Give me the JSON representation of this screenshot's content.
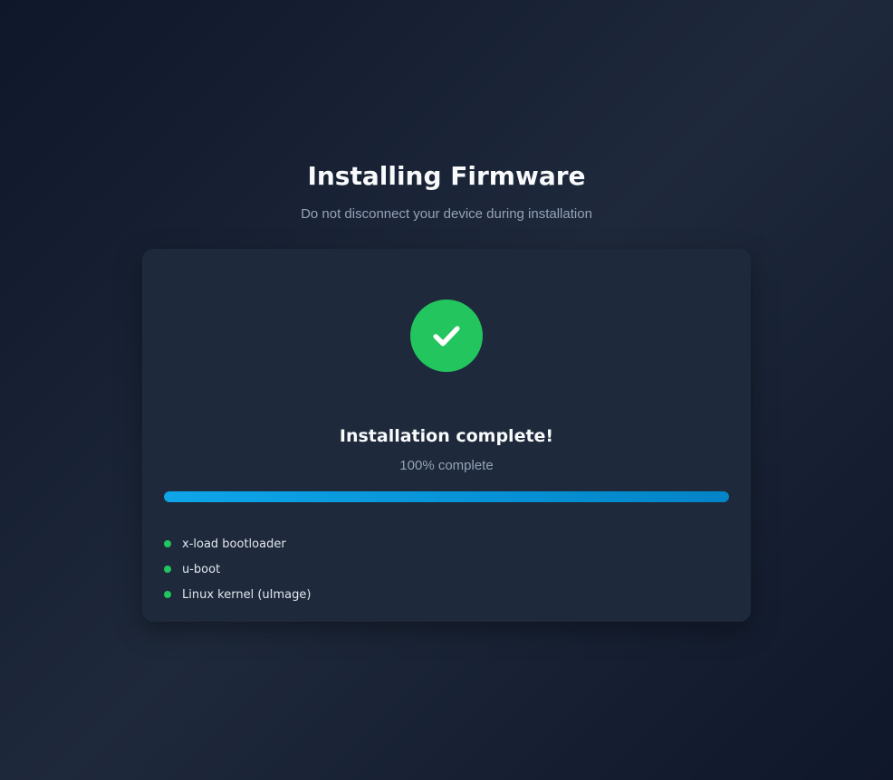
{
  "header": {
    "title": "Installing Firmware",
    "subtitle": "Do not disconnect your device during installation"
  },
  "status": {
    "icon": "checkmark-icon",
    "title": "Installation complete!",
    "percent_text": "100% complete",
    "progress": 1.0
  },
  "components": [
    {
      "label": "x-load bootloader",
      "state": "done"
    },
    {
      "label": "u-boot",
      "state": "done"
    },
    {
      "label": "Linux kernel (uImage)",
      "state": "done"
    }
  ],
  "colors": {
    "background": "#0f172a",
    "card": "#1e293b",
    "success": "#22c55e",
    "progress": "#0ea5e9",
    "muted_text": "#94a3b8"
  }
}
